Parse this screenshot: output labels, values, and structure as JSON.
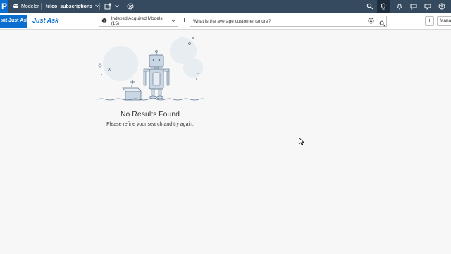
{
  "shell": {
    "logo_text": "P",
    "app_name": "Modeler",
    "model_name": "telco_subscriptions",
    "icons": [
      "cube-icon",
      "chevron-down-icon",
      "share-icon",
      "close-circle-icon",
      "search-icon",
      "lightbulb-icon",
      "bell-icon",
      "chat-icon",
      "feedback-icon",
      "help-icon"
    ]
  },
  "toolbar": {
    "exit_label": "xit Just Ask",
    "title": "Just Ask",
    "model_select_label": "Indexed Acquired Models (15)",
    "search_value": "What is the average customer tenure?",
    "info_label": "i",
    "manage_label": "Mana"
  },
  "empty_state": {
    "title": "No Results Found",
    "subtitle": "Please refine your search and try again."
  },
  "colors": {
    "shell": "#354a5f",
    "accent": "#0a6ed1"
  }
}
